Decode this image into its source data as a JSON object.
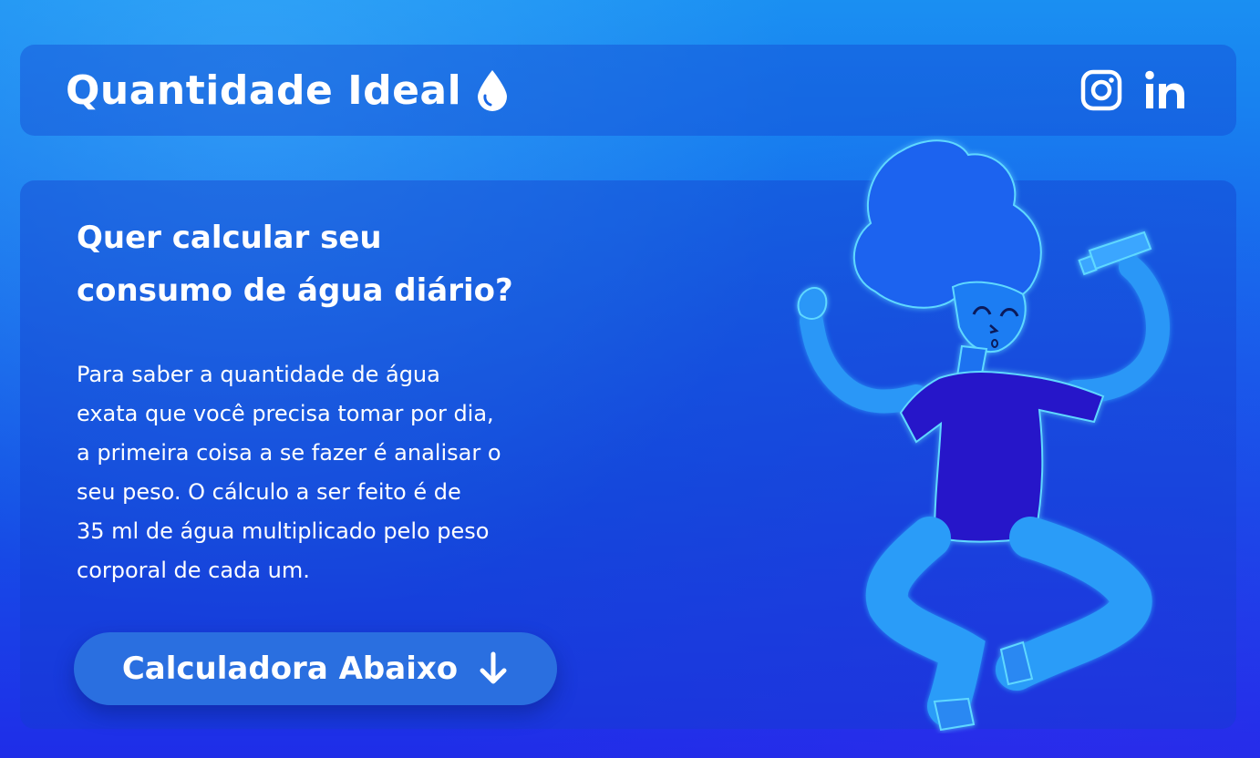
{
  "header": {
    "title": "Quantidade Ideal",
    "title_icon": "water-drop-icon",
    "socials": [
      {
        "name": "Instagram",
        "icon": "instagram-icon"
      },
      {
        "name": "LinkedIn",
        "icon": "linkedin-icon"
      }
    ]
  },
  "hero": {
    "headline_lines": [
      "Quer calcular seu",
      "consumo de água diário?"
    ],
    "description_lines": [
      "Para saber a quantidade de água",
      "exata que você precisa tomar por dia,",
      "a primeira coisa a se fazer é analisar o",
      "seu peso. O cálculo a ser feito é de",
      "35 ml de água multiplicado pelo peso",
      "corporal de cada um."
    ],
    "cta_label": "Calculadora Abaixo",
    "cta_icon": "arrow-down-icon",
    "illustration": "person-jumping-with-water-bottle"
  },
  "colors": {
    "background_top": "#1a8ff2",
    "background_bottom": "#1f2de8",
    "button": "#2a6fe0",
    "text": "#ffffff"
  }
}
